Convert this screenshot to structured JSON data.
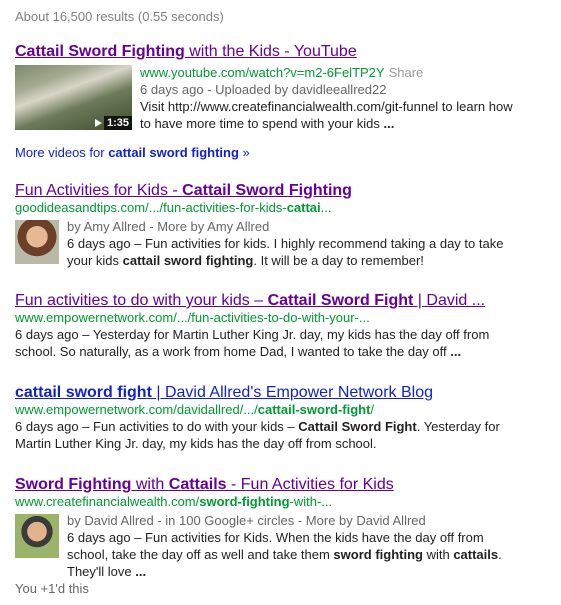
{
  "stats": "About 16,500 results (0.55 seconds)",
  "results": [
    {
      "title_a": "Cattail Sword Fighting",
      "title_b": " with the Kids - YouTube",
      "url": "www.youtube.com/watch?v=m2-6FelTP2Y",
      "share": "Share",
      "meta": "6 days ago - Uploaded by davidleeallred22",
      "snippet_a": "Visit http://www.createfinancialwealth.com/git-funnel to learn how",
      "snippet_b": "to have more time to spend with your kids ",
      "snippet_c": "...",
      "duration": "1:35"
    },
    {
      "title_a": "Fun Activities for Kids - ",
      "title_b": "Cattail Sword Fighting",
      "url_a": "goodideasandtips.com/.../fun-activities-for-kids-",
      "url_b": "cattai",
      "url_c": "...",
      "meta": "by Amy Allred - More by Amy Allred",
      "snippet_a": "6 days ago – Fun activities for kids. I highly recommend taking a day to take",
      "snippet_b": "your kids ",
      "snippet_bold": "cattail sword fighting",
      "snippet_c": ". It will be a day to remember!"
    },
    {
      "title_a": "Fun activities to do with your kids – ",
      "title_b": "Cattail Sword Fight",
      "title_c": " | David ...",
      "url": "www.empowernetwork.com/.../fun-activities-to-do-with-your-...",
      "snippet_a": "6 days ago – Yesterday for Martin Luther King Jr. day, my kids has the day off from",
      "snippet_b": "school. So naturally, as a work from home Dad, I wanted to take the day off ",
      "snippet_c": "..."
    },
    {
      "title_a": "cattail sword fight",
      "title_b": " | David Allred's Empower Network Blog",
      "url_a": "www.empowernetwork.com/davidallred/.../",
      "url_b": "cattail-sword-fight",
      "url_c": "/",
      "snippet_a": "6 days ago – Fun activities to do with your kids – ",
      "snippet_bold": "Cattail Sword Fight",
      "snippet_b": ". Yesterday for",
      "snippet_c": "Martin Luther King Jr. day, my kids has the day off from school."
    },
    {
      "title_a": "Sword Fighting",
      "title_b": " with ",
      "title_c": "Cattails",
      "title_d": " - Fun Activities for Kids",
      "url_a": "www.createfinancialwealth.com/",
      "url_b": "sword-fighting",
      "url_c": "-with-...",
      "meta": "by David Allred - in 100 Google+ circles - More by David Allred",
      "snippet_a": "6 days ago – Fun activities for Kids. When the kids have the day off from",
      "snippet_b": "school, take the day off as well and take them ",
      "snippet_bold1": "sword fighting",
      "snippet_mid": " with ",
      "snippet_bold2": "cattails",
      "snippet_c": ".",
      "snippet_d": "They'll love ",
      "snippet_e": "..."
    }
  ],
  "more_videos_a": "More videos for ",
  "more_videos_b": "cattail sword fighting",
  "more_videos_c": " »",
  "plus1": "You +1'd this",
  "colors": {
    "title": "#660099",
    "title_blue": "#1122cc",
    "url": "#009933",
    "meta": "#666666"
  }
}
